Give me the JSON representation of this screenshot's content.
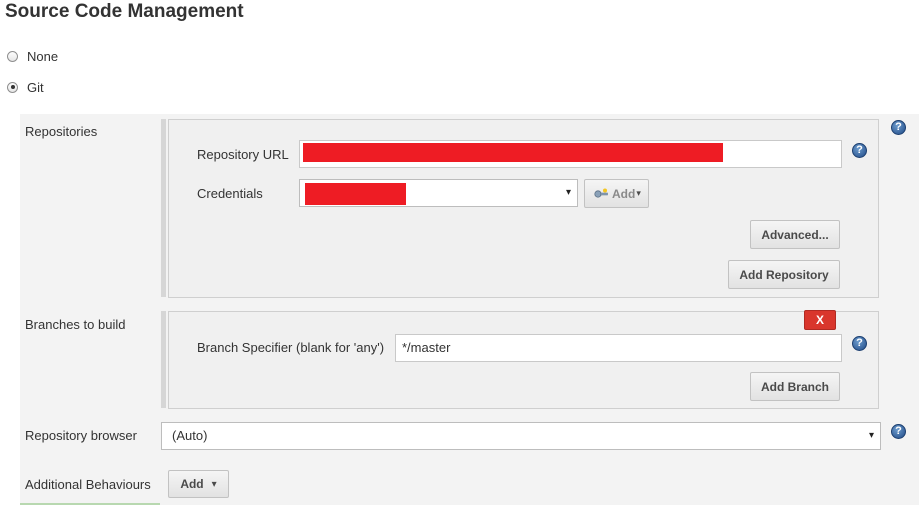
{
  "header": {
    "title": "Source Code Management"
  },
  "scm_options": [
    {
      "label": "None",
      "selected": false
    },
    {
      "label": "Git",
      "selected": true
    }
  ],
  "repositories": {
    "section_label": "Repositories",
    "url_label": "Repository URL",
    "url_value": "",
    "credentials_label": "Credentials",
    "credentials_value": "",
    "add_label": "Add",
    "advanced_label": "Advanced...",
    "add_repository_label": "Add Repository"
  },
  "branches": {
    "section_label": "Branches to build",
    "delete_label": "X",
    "specifier_label": "Branch Specifier (blank for 'any')",
    "specifier_value": "*/master",
    "add_branch_label": "Add Branch"
  },
  "repo_browser": {
    "label": "Repository browser",
    "value": "(Auto)"
  },
  "behaviours": {
    "label": "Additional Behaviours",
    "add_label": "Add"
  },
  "help_glyph": "?",
  "dropdown_glyph": "▾",
  "colors": {
    "redaction": "#ee1c24",
    "help_icon": "#204a87",
    "delete_button": "#d9362c"
  }
}
